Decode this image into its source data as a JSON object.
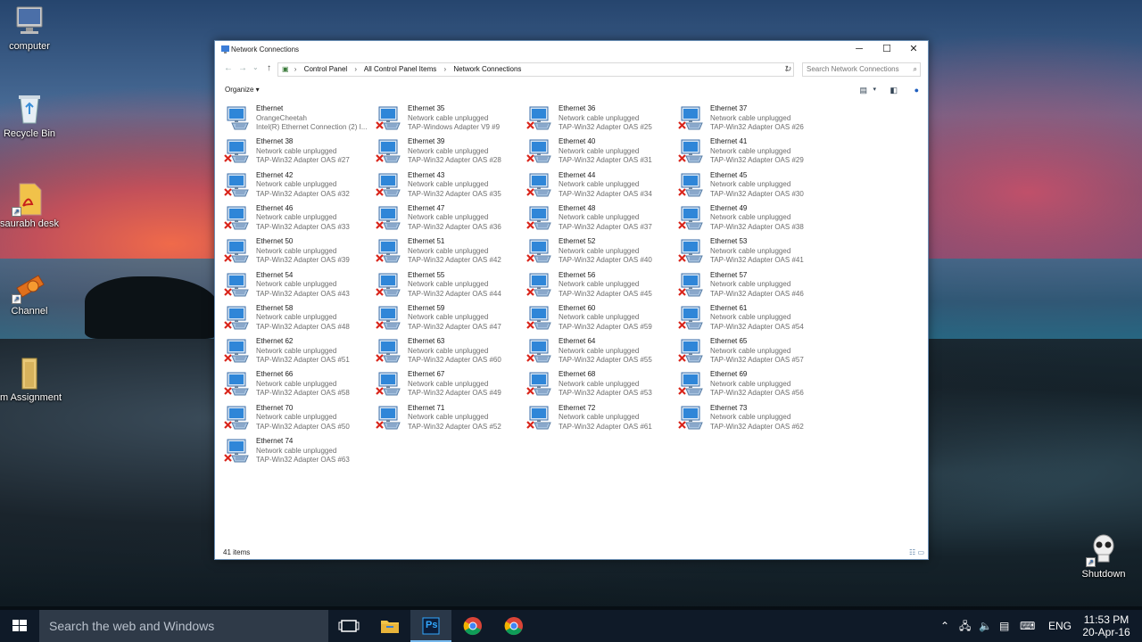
{
  "desktop": {
    "icons": [
      {
        "label": "computer"
      },
      {
        "label": "Recycle Bin"
      },
      {
        "label": "saurabh desk"
      },
      {
        "label": "Channel"
      },
      {
        "label": "Im Assignment"
      },
      {
        "label": "Shutdown"
      }
    ]
  },
  "window": {
    "title": "Network Connections",
    "controls": {
      "minimize": "─",
      "maximize": "☐",
      "close": "✕"
    },
    "nav": {
      "back": "←",
      "forward": "→",
      "recent": "⌄",
      "up": "↑"
    },
    "breadcrumb": [
      "Control Panel",
      "All Control Panel Items",
      "Network Connections"
    ],
    "breadcrumb_sep": "›",
    "search_placeholder": "Search Network Connections",
    "organize_label": "Organize ▾",
    "status_text": "41 items",
    "items": [
      {
        "name": "Ethernet",
        "status": "OrangeCheetah",
        "adapter": "Intel(R) Ethernet Connection (2) I...",
        "connected": true
      },
      {
        "name": "Ethernet 35",
        "status": "Network cable unplugged",
        "adapter": "TAP-Windows Adapter V9 #9",
        "connected": false
      },
      {
        "name": "Ethernet 36",
        "status": "Network cable unplugged",
        "adapter": "TAP-Win32 Adapter OAS #25",
        "connected": false
      },
      {
        "name": "Ethernet 37",
        "status": "Network cable unplugged",
        "adapter": "TAP-Win32 Adapter OAS #26",
        "connected": false
      },
      {
        "name": "Ethernet 38",
        "status": "Network cable unplugged",
        "adapter": "TAP-Win32 Adapter OAS #27",
        "connected": false
      },
      {
        "name": "Ethernet 39",
        "status": "Network cable unplugged",
        "adapter": "TAP-Win32 Adapter OAS #28",
        "connected": false
      },
      {
        "name": "Ethernet 40",
        "status": "Network cable unplugged",
        "adapter": "TAP-Win32 Adapter OAS #31",
        "connected": false
      },
      {
        "name": "Ethernet 41",
        "status": "Network cable unplugged",
        "adapter": "TAP-Win32 Adapter OAS #29",
        "connected": false
      },
      {
        "name": "Ethernet 42",
        "status": "Network cable unplugged",
        "adapter": "TAP-Win32 Adapter OAS #32",
        "connected": false
      },
      {
        "name": "Ethernet 43",
        "status": "Network cable unplugged",
        "adapter": "TAP-Win32 Adapter OAS #35",
        "connected": false
      },
      {
        "name": "Ethernet 44",
        "status": "Network cable unplugged",
        "adapter": "TAP-Win32 Adapter OAS #34",
        "connected": false
      },
      {
        "name": "Ethernet 45",
        "status": "Network cable unplugged",
        "adapter": "TAP-Win32 Adapter OAS #30",
        "connected": false
      },
      {
        "name": "Ethernet 46",
        "status": "Network cable unplugged",
        "adapter": "TAP-Win32 Adapter OAS #33",
        "connected": false
      },
      {
        "name": "Ethernet 47",
        "status": "Network cable unplugged",
        "adapter": "TAP-Win32 Adapter OAS #36",
        "connected": false
      },
      {
        "name": "Ethernet 48",
        "status": "Network cable unplugged",
        "adapter": "TAP-Win32 Adapter OAS #37",
        "connected": false
      },
      {
        "name": "Ethernet 49",
        "status": "Network cable unplugged",
        "adapter": "TAP-Win32 Adapter OAS #38",
        "connected": false
      },
      {
        "name": "Ethernet 50",
        "status": "Network cable unplugged",
        "adapter": "TAP-Win32 Adapter OAS #39",
        "connected": false
      },
      {
        "name": "Ethernet 51",
        "status": "Network cable unplugged",
        "adapter": "TAP-Win32 Adapter OAS #42",
        "connected": false
      },
      {
        "name": "Ethernet 52",
        "status": "Network cable unplugged",
        "adapter": "TAP-Win32 Adapter OAS #40",
        "connected": false
      },
      {
        "name": "Ethernet 53",
        "status": "Network cable unplugged",
        "adapter": "TAP-Win32 Adapter OAS #41",
        "connected": false
      },
      {
        "name": "Ethernet 54",
        "status": "Network cable unplugged",
        "adapter": "TAP-Win32 Adapter OAS #43",
        "connected": false
      },
      {
        "name": "Ethernet 55",
        "status": "Network cable unplugged",
        "adapter": "TAP-Win32 Adapter OAS #44",
        "connected": false
      },
      {
        "name": "Ethernet 56",
        "status": "Network cable unplugged",
        "adapter": "TAP-Win32 Adapter OAS #45",
        "connected": false
      },
      {
        "name": "Ethernet 57",
        "status": "Network cable unplugged",
        "adapter": "TAP-Win32 Adapter OAS #46",
        "connected": false
      },
      {
        "name": "Ethernet 58",
        "status": "Network cable unplugged",
        "adapter": "TAP-Win32 Adapter OAS #48",
        "connected": false
      },
      {
        "name": "Ethernet 59",
        "status": "Network cable unplugged",
        "adapter": "TAP-Win32 Adapter OAS #47",
        "connected": false
      },
      {
        "name": "Ethernet 60",
        "status": "Network cable unplugged",
        "adapter": "TAP-Win32 Adapter OAS #59",
        "connected": false
      },
      {
        "name": "Ethernet 61",
        "status": "Network cable unplugged",
        "adapter": "TAP-Win32 Adapter OAS #54",
        "connected": false
      },
      {
        "name": "Ethernet 62",
        "status": "Network cable unplugged",
        "adapter": "TAP-Win32 Adapter OAS #51",
        "connected": false
      },
      {
        "name": "Ethernet 63",
        "status": "Network cable unplugged",
        "adapter": "TAP-Win32 Adapter OAS #60",
        "connected": false
      },
      {
        "name": "Ethernet 64",
        "status": "Network cable unplugged",
        "adapter": "TAP-Win32 Adapter OAS #55",
        "connected": false
      },
      {
        "name": "Ethernet 65",
        "status": "Network cable unplugged",
        "adapter": "TAP-Win32 Adapter OAS #57",
        "connected": false
      },
      {
        "name": "Ethernet 66",
        "status": "Network cable unplugged",
        "adapter": "TAP-Win32 Adapter OAS #58",
        "connected": false
      },
      {
        "name": "Ethernet 67",
        "status": "Network cable unplugged",
        "adapter": "TAP-Win32 Adapter OAS #49",
        "connected": false
      },
      {
        "name": "Ethernet 68",
        "status": "Network cable unplugged",
        "adapter": "TAP-Win32 Adapter OAS #53",
        "connected": false
      },
      {
        "name": "Ethernet 69",
        "status": "Network cable unplugged",
        "adapter": "TAP-Win32 Adapter OAS #56",
        "connected": false
      },
      {
        "name": "Ethernet 70",
        "status": "Network cable unplugged",
        "adapter": "TAP-Win32 Adapter OAS #50",
        "connected": false
      },
      {
        "name": "Ethernet 71",
        "status": "Network cable unplugged",
        "adapter": "TAP-Win32 Adapter OAS #52",
        "connected": false
      },
      {
        "name": "Ethernet 72",
        "status": "Network cable unplugged",
        "adapter": "TAP-Win32 Adapter OAS #61",
        "connected": false
      },
      {
        "name": "Ethernet 73",
        "status": "Network cable unplugged",
        "adapter": "TAP-Win32 Adapter OAS #62",
        "connected": false
      },
      {
        "name": "Ethernet 74",
        "status": "Network cable unplugged",
        "adapter": "TAP-Win32 Adapter OAS #63",
        "connected": false
      }
    ]
  },
  "taskbar": {
    "search_placeholder": "Search the web and Windows",
    "apps": [
      "task-view-icon",
      "file-explorer-icon",
      "photoshop-icon",
      "chrome-icon",
      "chrome-icon"
    ],
    "photoshop_label": "Ps",
    "language": "ENG",
    "time": "11:53 PM",
    "date": "20-Apr-16"
  },
  "colors": {
    "accent": "#76b9ed",
    "taskbar": "#0f1a28",
    "error_x": "#d9261c",
    "monitor_blue": "#2f86d8"
  }
}
